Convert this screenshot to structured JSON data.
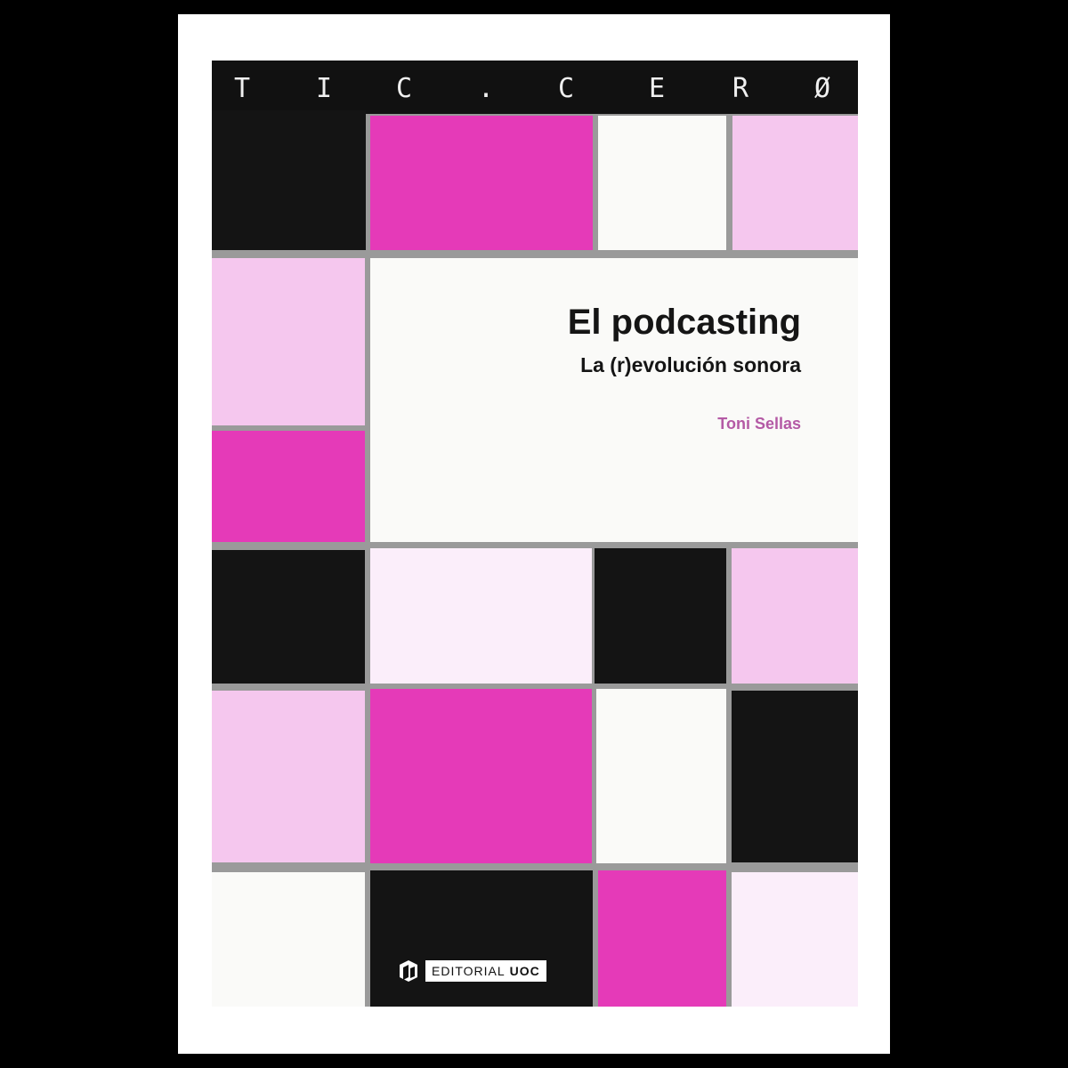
{
  "cover": {
    "series_letters": [
      "T",
      "I",
      "C",
      ".",
      "C",
      "E",
      "R",
      "Ø"
    ],
    "title": "El podcasting",
    "subtitle": "La (r)evolución sonora",
    "author": "Toni Sellas",
    "publisher": {
      "name": "EDITORIAL",
      "name_strong": "UOC",
      "logo_icon": "cube-logo-icon"
    }
  },
  "colors": {
    "background": "#000000",
    "page": "#ffffff",
    "black_tile": "#141414",
    "magenta_tile": "#e53ab8",
    "light_pink_tile": "#f5c7ee",
    "pale_pink_tile": "#fbeefa",
    "white_tile": "#fafaf8",
    "author_text": "#b45aa5"
  }
}
